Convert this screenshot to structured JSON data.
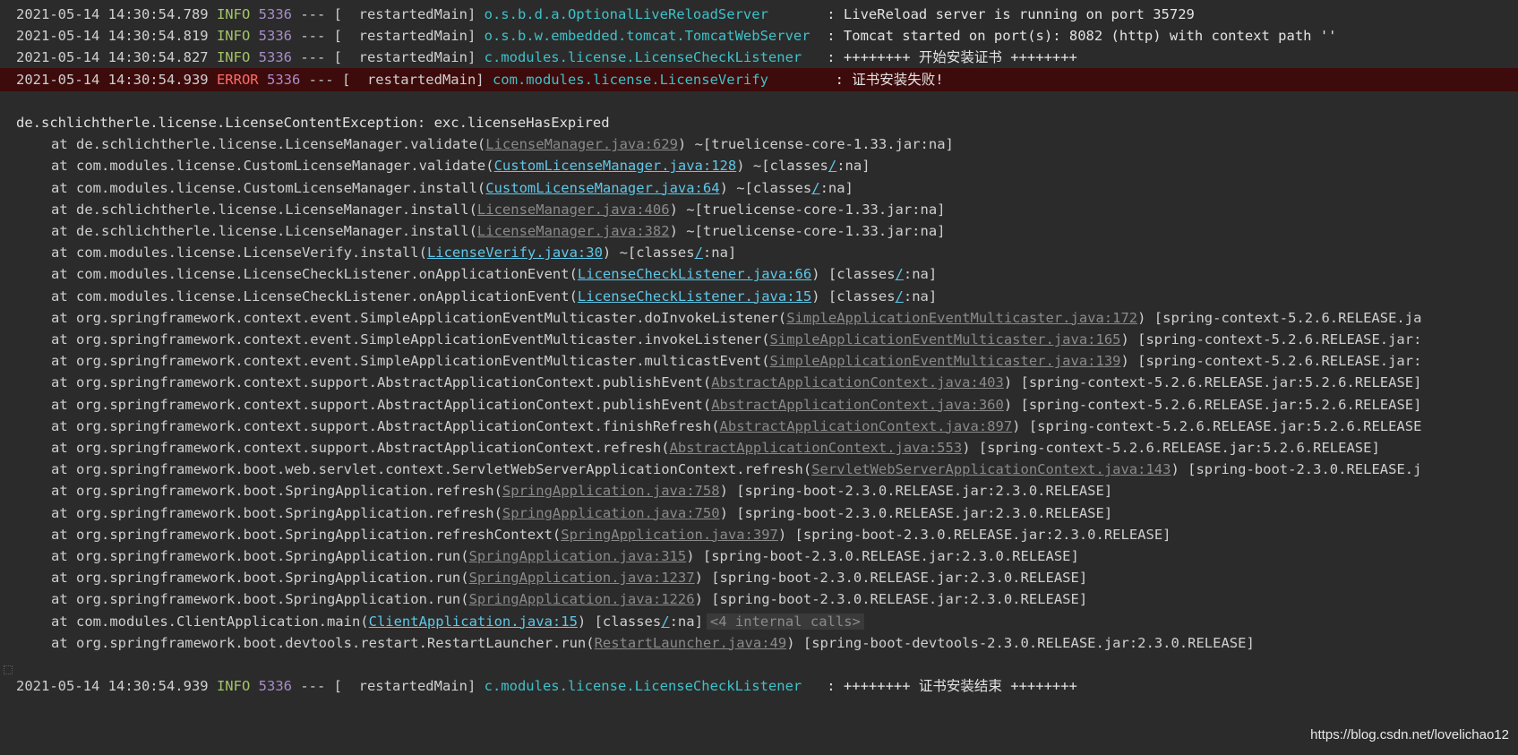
{
  "log_lines": [
    {
      "timestamp": "2021-05-14 14:30:54.789",
      "level": "INFO",
      "level_pad": " INFO",
      "pid": "5336",
      "separator": " --- [",
      "thread": "  restartedMain]",
      "logger": "o.s.b.d.a.OptionalLiveReloadServer      ",
      "message": " : LiveReload server is running on port 35729"
    },
    {
      "timestamp": "2021-05-14 14:30:54.819",
      "level": "INFO",
      "level_pad": " INFO",
      "pid": "5336",
      "separator": " --- [",
      "thread": "  restartedMain]",
      "logger": "o.s.b.w.embedded.tomcat.TomcatWebServer ",
      "message": " : Tomcat started on port(s): 8082 (http) with context path ''"
    },
    {
      "timestamp": "2021-05-14 14:30:54.827",
      "level": "INFO",
      "level_pad": " INFO",
      "pid": "5336",
      "separator": " --- [",
      "thread": "  restartedMain]",
      "logger": "c.modules.license.LicenseCheckListener  ",
      "message": " : ++++++++ 开始安装证书 ++++++++"
    },
    {
      "timestamp": "2021-05-14 14:30:54.939",
      "level": "ERROR",
      "level_pad": " ERROR",
      "pid": "5336",
      "separator": " --- [",
      "thread": "  restartedMain]",
      "logger": "com.modules.license.LicenseVerify       ",
      "message": " : 证书安装失败!"
    }
  ],
  "exception": "de.schlichtherle.license.LicenseContentException: exc.licenseHasExpired",
  "stack_frames": [
    {
      "prefix": "at de.schlichtherle.license.LicenseManager.validate(",
      "link": "LicenseManager.java:629",
      "link_style": "gray",
      "suffix": ") ~[truelicense-core-1.33.jar:na]"
    },
    {
      "prefix": "at com.modules.license.CustomLicenseManager.validate(",
      "link": "CustomLicenseManager.java:128",
      "link_style": "cyan",
      "suffix": ") ~[classes",
      "classes_link": "/",
      "tail": ":na]"
    },
    {
      "prefix": "at com.modules.license.CustomLicenseManager.install(",
      "link": "CustomLicenseManager.java:64",
      "link_style": "cyan",
      "suffix": ") ~[classes",
      "classes_link": "/",
      "tail": ":na]"
    },
    {
      "prefix": "at de.schlichtherle.license.LicenseManager.install(",
      "link": "LicenseManager.java:406",
      "link_style": "gray",
      "suffix": ") ~[truelicense-core-1.33.jar:na]"
    },
    {
      "prefix": "at de.schlichtherle.license.LicenseManager.install(",
      "link": "LicenseManager.java:382",
      "link_style": "gray",
      "suffix": ") ~[truelicense-core-1.33.jar:na]"
    },
    {
      "prefix": "at com.modules.license.LicenseVerify.install(",
      "link": "LicenseVerify.java:30",
      "link_style": "cyan",
      "suffix": ") ~[classes",
      "classes_link": "/",
      "tail": ":na]"
    },
    {
      "prefix": "at com.modules.license.LicenseCheckListener.onApplicationEvent(",
      "link": "LicenseCheckListener.java:66",
      "link_style": "cyan",
      "suffix": ") [classes",
      "classes_link": "/",
      "tail": ":na]"
    },
    {
      "prefix": "at com.modules.license.LicenseCheckListener.onApplicationEvent(",
      "link": "LicenseCheckListener.java:15",
      "link_style": "cyan",
      "suffix": ") [classes",
      "classes_link": "/",
      "tail": ":na]"
    },
    {
      "prefix": "at org.springframework.context.event.SimpleApplicationEventMulticaster.doInvokeListener(",
      "link": "SimpleApplicationEventMulticaster.java:172",
      "link_style": "gray",
      "suffix": ") [spring-context-5.2.6.RELEASE.ja"
    },
    {
      "prefix": "at org.springframework.context.event.SimpleApplicationEventMulticaster.invokeListener(",
      "link": "SimpleApplicationEventMulticaster.java:165",
      "link_style": "gray",
      "suffix": ") [spring-context-5.2.6.RELEASE.jar:"
    },
    {
      "prefix": "at org.springframework.context.event.SimpleApplicationEventMulticaster.multicastEvent(",
      "link": "SimpleApplicationEventMulticaster.java:139",
      "link_style": "gray",
      "suffix": ") [spring-context-5.2.6.RELEASE.jar:"
    },
    {
      "prefix": "at org.springframework.context.support.AbstractApplicationContext.publishEvent(",
      "link": "AbstractApplicationContext.java:403",
      "link_style": "gray",
      "suffix": ") [spring-context-5.2.6.RELEASE.jar:5.2.6.RELEASE]"
    },
    {
      "prefix": "at org.springframework.context.support.AbstractApplicationContext.publishEvent(",
      "link": "AbstractApplicationContext.java:360",
      "link_style": "gray",
      "suffix": ") [spring-context-5.2.6.RELEASE.jar:5.2.6.RELEASE]"
    },
    {
      "prefix": "at org.springframework.context.support.AbstractApplicationContext.finishRefresh(",
      "link": "AbstractApplicationContext.java:897",
      "link_style": "gray",
      "suffix": ") [spring-context-5.2.6.RELEASE.jar:5.2.6.RELEASE"
    },
    {
      "prefix": "at org.springframework.context.support.AbstractApplicationContext.refresh(",
      "link": "AbstractApplicationContext.java:553",
      "link_style": "gray",
      "suffix": ") [spring-context-5.2.6.RELEASE.jar:5.2.6.RELEASE]"
    },
    {
      "prefix": "at org.springframework.boot.web.servlet.context.ServletWebServerApplicationContext.refresh(",
      "link": "ServletWebServerApplicationContext.java:143",
      "link_style": "gray",
      "suffix": ") [spring-boot-2.3.0.RELEASE.j"
    },
    {
      "prefix": "at org.springframework.boot.SpringApplication.refresh(",
      "link": "SpringApplication.java:758",
      "link_style": "gray",
      "suffix": ") [spring-boot-2.3.0.RELEASE.jar:2.3.0.RELEASE]"
    },
    {
      "prefix": "at org.springframework.boot.SpringApplication.refresh(",
      "link": "SpringApplication.java:750",
      "link_style": "gray",
      "suffix": ") [spring-boot-2.3.0.RELEASE.jar:2.3.0.RELEASE]"
    },
    {
      "prefix": "at org.springframework.boot.SpringApplication.refreshContext(",
      "link": "SpringApplication.java:397",
      "link_style": "gray",
      "suffix": ") [spring-boot-2.3.0.RELEASE.jar:2.3.0.RELEASE]"
    },
    {
      "prefix": "at org.springframework.boot.SpringApplication.run(",
      "link": "SpringApplication.java:315",
      "link_style": "gray",
      "suffix": ") [spring-boot-2.3.0.RELEASE.jar:2.3.0.RELEASE]"
    },
    {
      "prefix": "at org.springframework.boot.SpringApplication.run(",
      "link": "SpringApplication.java:1237",
      "link_style": "gray",
      "suffix": ") [spring-boot-2.3.0.RELEASE.jar:2.3.0.RELEASE]"
    },
    {
      "prefix": "at org.springframework.boot.SpringApplication.run(",
      "link": "SpringApplication.java:1226",
      "link_style": "gray",
      "suffix": ") [spring-boot-2.3.0.RELEASE.jar:2.3.0.RELEASE]"
    },
    {
      "prefix": "at com.modules.ClientApplication.main(",
      "link": "ClientApplication.java:15",
      "link_style": "cyan",
      "suffix": ") [classes",
      "classes_link": "/",
      "tail": ":na]",
      "internal": "<4 internal calls>"
    },
    {
      "prefix": "at org.springframework.boot.devtools.restart.RestartLauncher.run(",
      "link": "RestartLauncher.java:49",
      "link_style": "gray",
      "suffix": ") [spring-boot-devtools-2.3.0.RELEASE.jar:2.3.0.RELEASE]"
    }
  ],
  "final_line": {
    "timestamp": "2021-05-14 14:30:54.939",
    "level": "INFO",
    "level_pad": " INFO",
    "pid": "5336",
    "separator": " --- [",
    "thread": "  restartedMain]",
    "logger": "c.modules.license.LicenseCheckListener  ",
    "message": " : ++++++++ 证书安装结束 ++++++++"
  },
  "watermark": "https://blog.csdn.net/lovelichao12",
  "colors": {
    "background": "#2b2b2b",
    "error_row": "#3d0b0b",
    "info_level": "#a4c46a",
    "error_level": "#ff6b68",
    "pid": "#a98dc9",
    "logger": "#3ec1c9",
    "link_cyan": "#5fc7e8",
    "link_gray": "#8a8a8a"
  }
}
